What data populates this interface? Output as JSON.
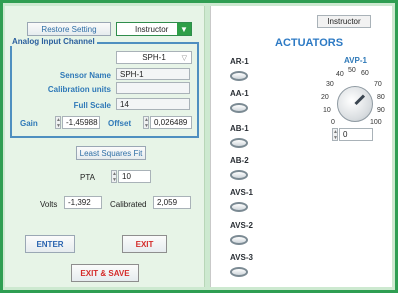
{
  "toolbar": {
    "restore_label": "Restore Setting",
    "instructor_select": "Instructor"
  },
  "analog_panel": {
    "title": "Analog Input Channel",
    "channel_select": "SPH-1",
    "sensor_name_label": "Sensor Name",
    "sensor_name_value": "SPH-1",
    "calibration_units_label": "Calibration units",
    "calibration_units_value": "",
    "full_scale_label": "Full Scale",
    "full_scale_value": "14",
    "gain_label": "Gain",
    "gain_value": "-1,45988",
    "offset_label": "Offset",
    "offset_value": "0,026489"
  },
  "least_squares": {
    "label": "Least Squares Fit"
  },
  "pta": {
    "label": "PTA",
    "value": "10"
  },
  "readouts": {
    "volts_label": "Volts",
    "volts_value": "-1,392",
    "calibrated_label": "Calibrated",
    "calibrated_value": "2,059"
  },
  "actions": {
    "enter": "ENTER",
    "exit": "EXIT",
    "exit_save": "EXIT & SAVE"
  },
  "right_panel": {
    "mode_label": "Instructor",
    "title": "ACTUATORS",
    "actuators": [
      "AR-1",
      "AA-1",
      "AB-1",
      "AB-2",
      "AVS-1",
      "AVS-2",
      "AVS-3"
    ],
    "dial": {
      "label": "AVP-1",
      "scale": [
        "0",
        "10",
        "20",
        "30",
        "40",
        "50",
        "60",
        "70",
        "80",
        "90",
        "100"
      ],
      "value": "0"
    }
  },
  "icons": {
    "dropdown": "chevron-down-icon",
    "spinner": "spinner-arrows-icon",
    "led": "led-indicator-icon",
    "knob": "knob-icon"
  }
}
